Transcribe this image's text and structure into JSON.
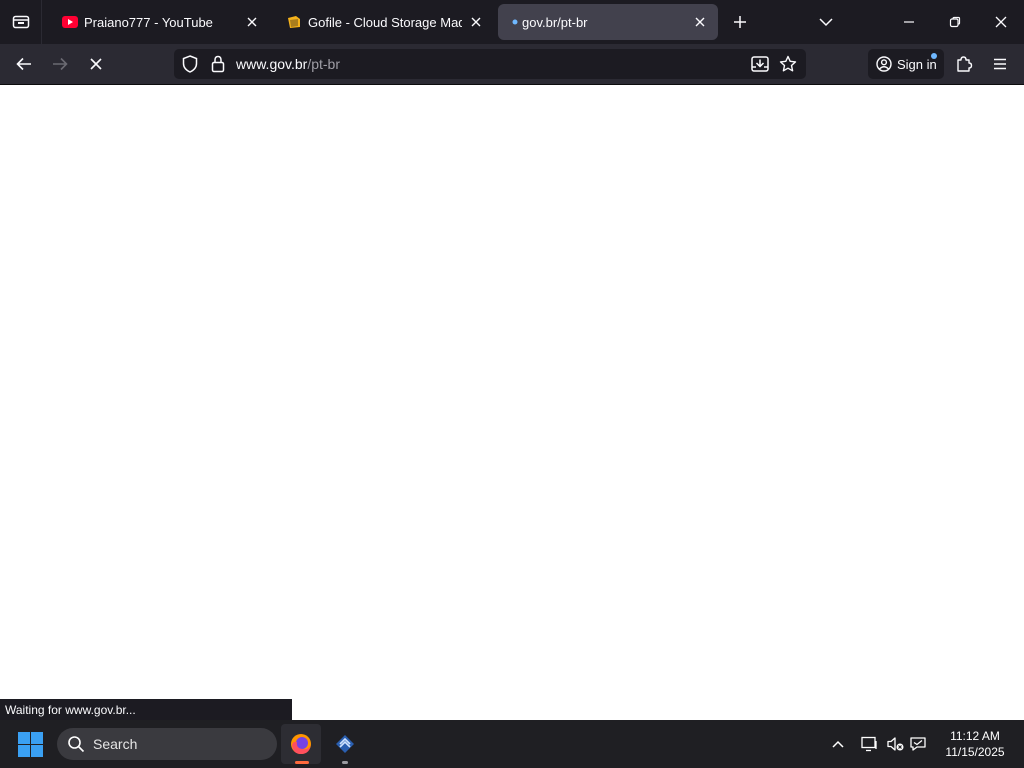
{
  "tabs": [
    {
      "title": "Praiano777 - YouTube"
    },
    {
      "title": "Gofile - Cloud Storage Made Simple"
    },
    {
      "title": "gov.br/pt-br"
    }
  ],
  "address": {
    "host": "www.gov.br",
    "path": "/pt-br"
  },
  "account": {
    "sign_in_label": "Sign in"
  },
  "status": {
    "text": "Waiting for www.gov.br..."
  },
  "taskbar": {
    "search_label": "Search"
  },
  "clock": {
    "time": "11:12 AM",
    "date": "11/15/2025"
  },
  "colors": {
    "accent": "#3aa0f3",
    "youtube": "#ff0033",
    "firefox_indicator": "#ff6a3d"
  }
}
